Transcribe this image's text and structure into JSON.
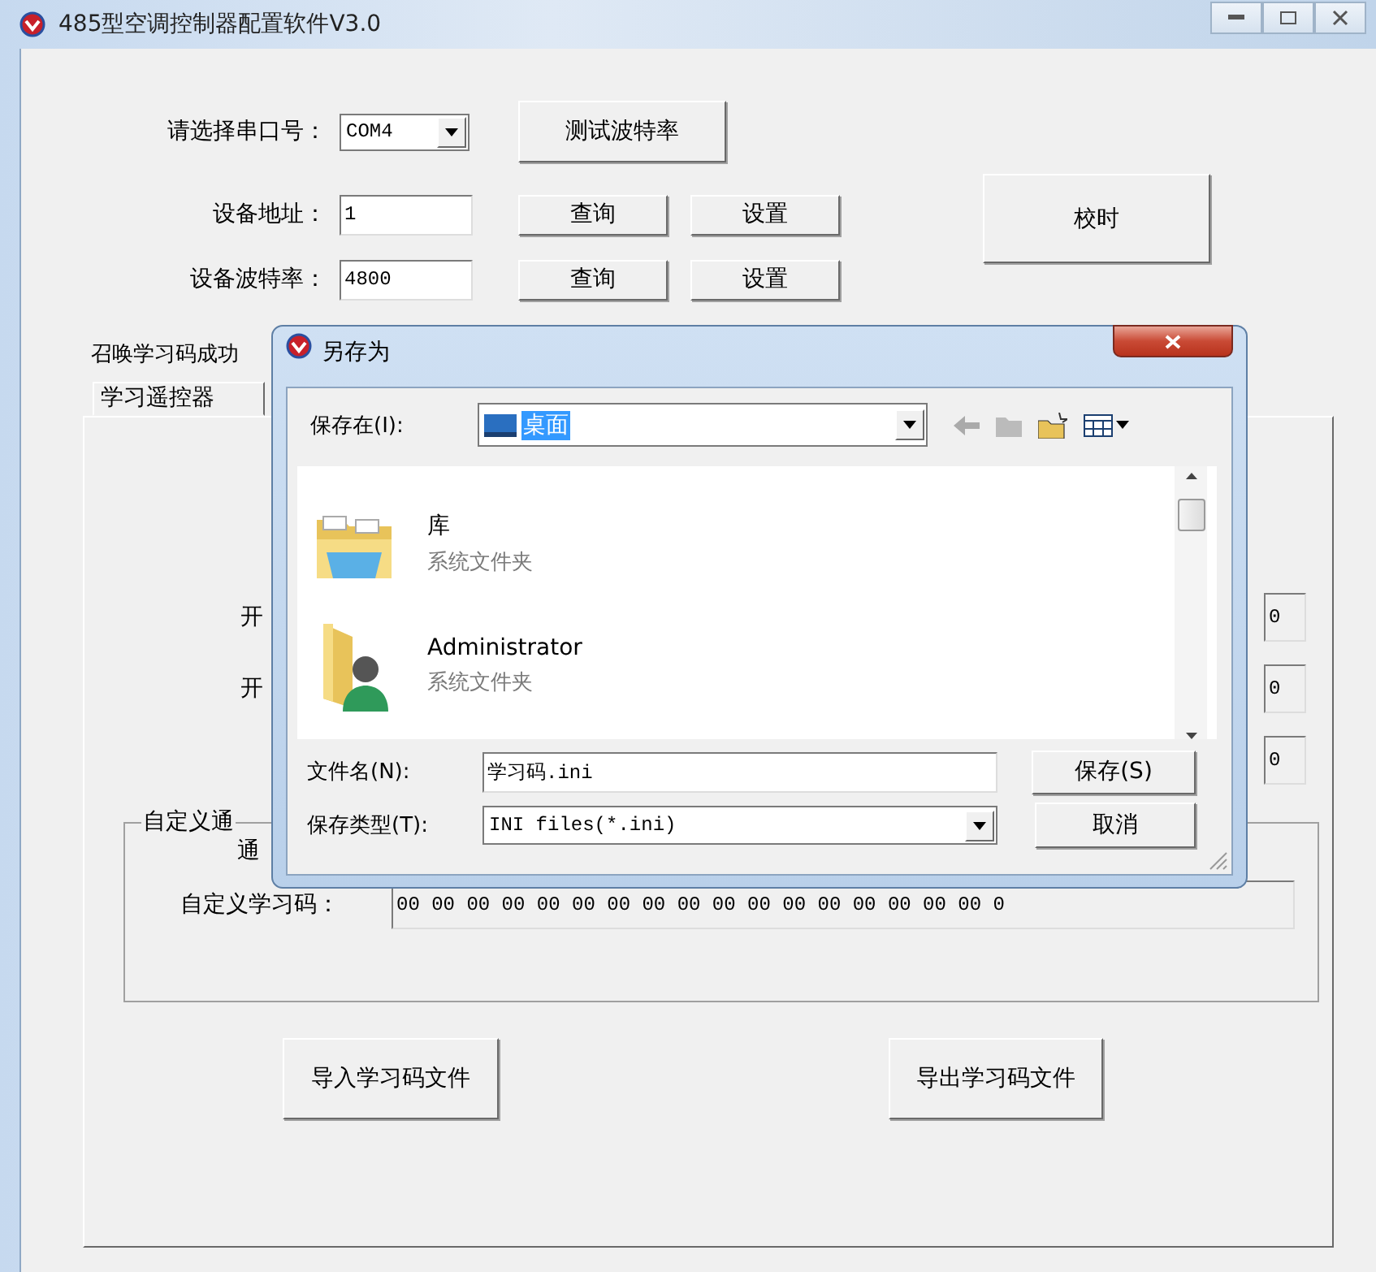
{
  "window": {
    "title": "485型空调控制器配置软件V3.0"
  },
  "serial": {
    "label": "请选择串口号：",
    "port": "COM4",
    "test_button": "测试波特率"
  },
  "device_rows": [
    {
      "label": "设备地址：",
      "value": "1",
      "query_button": "查询",
      "set_button": "设置"
    },
    {
      "label": "设备波特率：",
      "value": "4800",
      "query_button": "查询",
      "set_button": "设置"
    }
  ],
  "time_button": "校时",
  "status": "召唤学习码成功",
  "tabs": [
    {
      "label": "学习遥控器",
      "selected": true
    }
  ],
  "panel": {
    "code_rows": [
      {
        "label": "开",
        "value": "0"
      },
      {
        "label": "开",
        "value": "0"
      },
      {
        "label": "",
        "value": "0"
      }
    ],
    "group": {
      "title": "自定义通",
      "channel_label": "通",
      "code_label": "自定义学习码：",
      "code_value": "00 00 00 00 00 00 00 00 00 00 00 00 00 00 00 00 00 0"
    },
    "import_button": "导入学习码文件",
    "export_button": "导出学习码文件"
  },
  "dialog": {
    "title": "另存为",
    "save_in_label": "保存在(I):",
    "save_in_value": "桌面",
    "items": [
      {
        "name": "库",
        "type": "系统文件夹",
        "kind": "library"
      },
      {
        "name": "Administrator",
        "type": "系统文件夹",
        "kind": "user"
      }
    ],
    "filename_label": "文件名(N):",
    "filename": "学习码.ini",
    "filetype_label": "保存类型(T):",
    "filetype": "INI files(*.ini)",
    "save_button": "保存(S)",
    "cancel_button": "取消"
  }
}
